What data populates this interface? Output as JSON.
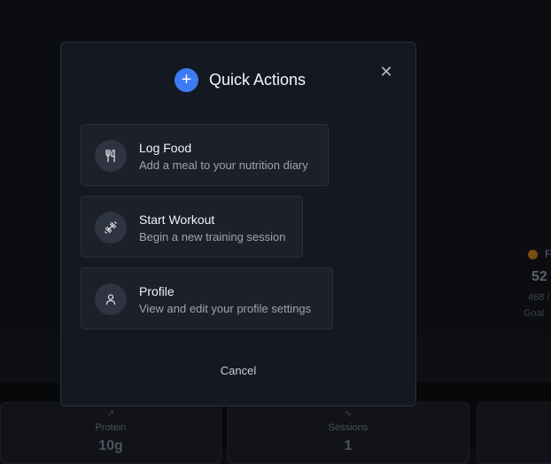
{
  "modal": {
    "title": "Quick Actions",
    "plus_icon": "plus-icon",
    "close_icon": "close-icon",
    "cancel_label": "Cancel",
    "accent_color": "#3d7bf3",
    "actions": [
      {
        "title": "Log Food",
        "description": "Add a meal to your nutrition diary",
        "icon": "utensils-icon"
      },
      {
        "title": "Start Workout",
        "description": "Begin a new training session",
        "icon": "dumbbell-icon"
      },
      {
        "title": "Profile",
        "description": "View and edit your profile settings",
        "icon": "user-icon"
      }
    ]
  },
  "background": {
    "stat": {
      "label": "F",
      "value": "52",
      "sub": "468 /",
      "goal": "Goal",
      "dot_color": "#7a4a17"
    },
    "cards": [
      {
        "label": "Protein",
        "value": "10g",
        "icon": "trend-up-icon"
      },
      {
        "label": "Sessions",
        "value": "1",
        "icon": "activity-icon"
      }
    ]
  }
}
